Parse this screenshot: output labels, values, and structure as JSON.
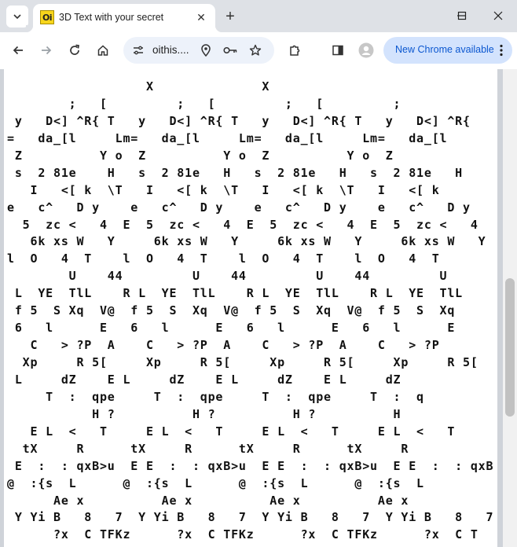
{
  "browser": {
    "tab": {
      "favicon_text": "Oi",
      "title": "3D Text with your secret",
      "close_glyph": "✕"
    },
    "new_tab_glyph": "+",
    "omnibox": {
      "url": "oithis...."
    },
    "update_button": {
      "label": "New Chrome available"
    }
  },
  "icons": {
    "tab_search": "chevron-down-icon",
    "back": "back-arrow-icon",
    "forward": "forward-arrow-icon",
    "reload": "reload-icon",
    "home": "home-icon",
    "site_info": "tune-icon",
    "location": "location-pin-icon",
    "password": "key-icon",
    "bookmark": "star-icon",
    "extensions": "puzzle-icon",
    "side_panel": "side-panel-icon",
    "profile": "profile-avatar-icon",
    "menu": "kebab-menu-icon"
  },
  "colors": {
    "tab_strip": "#dee1e6",
    "omnibox": "#edf2fa",
    "update_pill": "#d3e3fd",
    "update_text": "#0b57d0"
  },
  "page": {
    "art_lines": [
      "                  X              X",
      "        ;   [         ;   [         ;   [         ;",
      " y   D<] ^R{ T   y   D<] ^R{ T   y   D<] ^R{ T   y   D<] ^R{",
      "=   da_[l     Lm=   da_[l     Lm=   da_[l     Lm=   da_[l",
      " Z          Y o  Z          Y o  Z          Y o  Z",
      " s  2 81e    H   s  2 81e   H   s  2 81e   H   s  2 81e   H",
      "   I   <[ k  \\T   I   <[ k  \\T   I   <[ k  \\T   I   <[ k",
      "e   c^   D y    e   c^   D y    e   c^   D y    e   c^   D y",
      "  5  zc <   4  E  5  zc <   4  E  5  zc <   4  E  5  zc <   4",
      "   6k xs W   Y     6k xs W   Y     6k xs W   Y     6k xs W   Y",
      "l  O   4  T    l  O   4  T    l  O   4  T    l  O   4  T",
      "        U    44         U    44         U    44         U",
      " L  YE  TlL    R L  YE  TlL    R L  YE  TlL    R L  YE  TlL",
      " f 5  S Xq  V@  f 5  S  Xq  V@  f 5  S  Xq  V@  f 5  S  Xq",
      " 6   l      E   6   l      E   6   l      E   6   l      E",
      "   C   > ?P  A    C   > ?P  A    C   > ?P  A    C   > ?P",
      "  Xp     R 5[     Xp     R 5[     Xp     R 5[     Xp     R 5[",
      " L     dZ    E L     dZ    E L     dZ    E L     dZ",
      "     T  :  qpe     T  :  qpe     T  :  qpe     T  :  q",
      "           H ?          H ?          H ?          H",
      "   E L  <   T     E L  <   T     E L  <   T     E L  <   T",
      "  tX     R      tX     R      tX     R      tX     R",
      " E  :  : qxB>u  E E  :  : qxB>u  E E  :  : qxB>u  E E  :  : qxB>u",
      "@  :{s  L      @  :{s  L      @  :{s  L      @  :{s  L",
      "      Ae x          Ae x          Ae x          Ae x",
      " Y Yi B   8   7  Y Yi B   8   7  Y Yi B   8   7  Y Yi B   8   7",
      "      ?x  C TFKz      ?x  C TFKz      ?x  C TFKz      ?x  C T"
    ]
  }
}
